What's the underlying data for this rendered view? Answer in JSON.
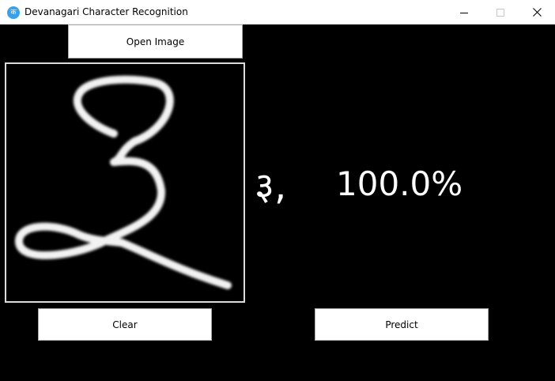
{
  "window": {
    "title": "Devanagari Character Recognition",
    "icon_glyph": "क"
  },
  "controls": {
    "minimize_icon": "minimize-icon",
    "maximize_icon": "maximize-icon",
    "close_icon": "close-icon"
  },
  "buttons": {
    "open_image": "Open Image",
    "clear": "Clear",
    "predict": "Predict"
  },
  "prediction": {
    "character": "३,",
    "confidence": "100.0%"
  },
  "colors": {
    "background": "#000000",
    "titlebar": "#ffffff",
    "text_on_dark": "#ffffff",
    "app_icon": "#3aa0e8"
  }
}
